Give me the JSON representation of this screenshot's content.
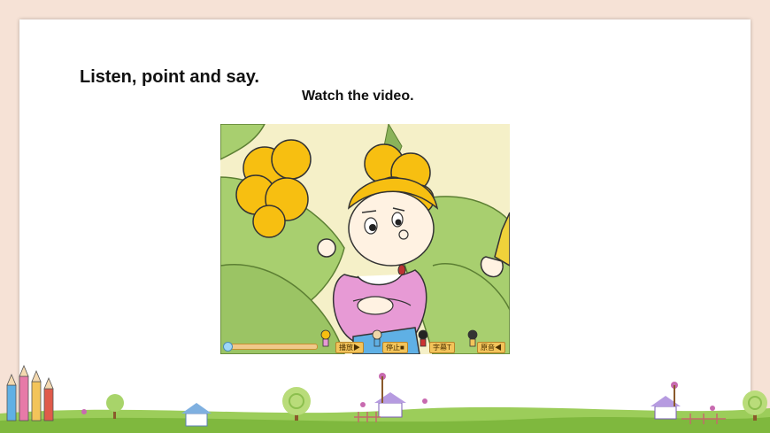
{
  "slide": {
    "title": "Listen, point and say.",
    "subtitle": "Watch the video."
  },
  "video": {
    "progress_fraction": 0.02,
    "controls": {
      "play_label": "播放▶",
      "stop_label": "停止■",
      "subtitle_label": "字幕T",
      "sound_label": "原音◀"
    }
  },
  "colors": {
    "page_border": "#f6e2d6",
    "hair": "#f7bf11",
    "leaf_green": "#a8cf6f",
    "dress_pink": "#e79ad5",
    "control_gold": "#f3c45a"
  }
}
